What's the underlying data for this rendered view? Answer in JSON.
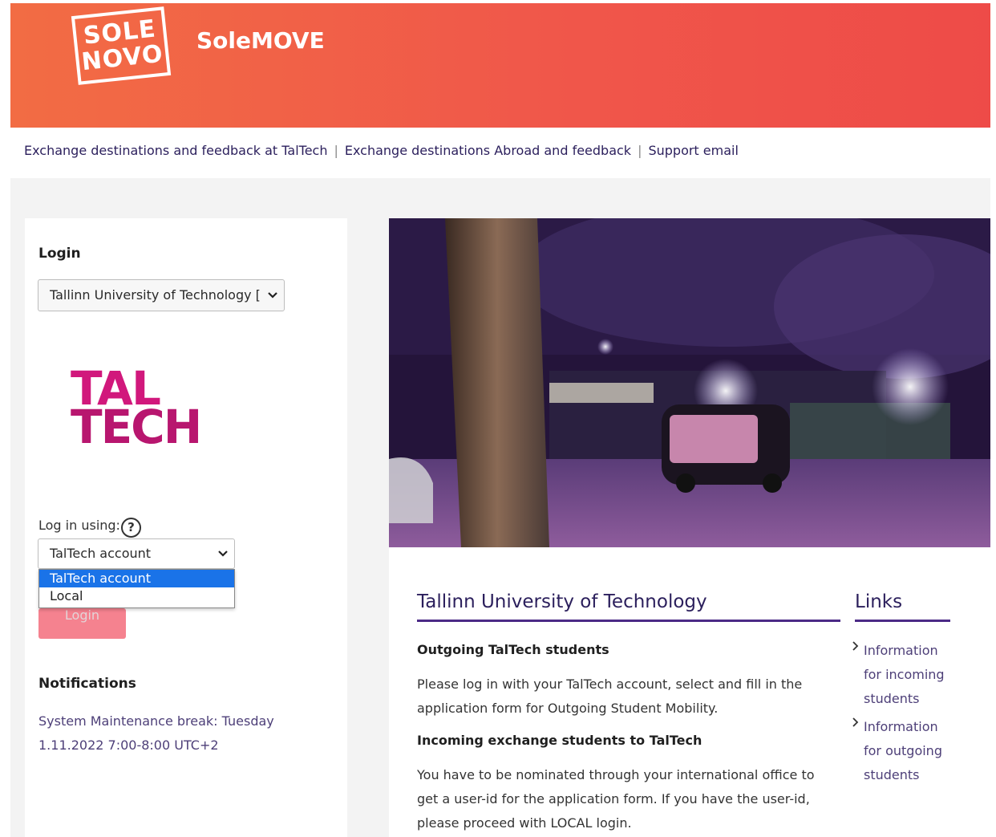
{
  "header": {
    "logo_line1": "SOLE",
    "logo_line2": "NOVO",
    "brand": "SoleMOVE"
  },
  "top_links": [
    "Exchange destinations and feedback at TalTech",
    "Exchange destinations Abroad and feedback",
    "Support email"
  ],
  "login": {
    "heading": "Login",
    "institution_select_value": "Tallinn University of Technology [Tallinn",
    "institution_logo_line1": "TAL",
    "institution_logo_line2": "TECH",
    "log_in_using_label": "Log in using:",
    "help_icon": "?",
    "method_select_value": "TalTech account",
    "method_options": [
      "TalTech account",
      "Local"
    ],
    "button_label": "Login"
  },
  "notifications": {
    "heading": "Notifications",
    "text": "System Maintenance break: Tuesday 1.11.2022 7:00-8:00 UTC+2"
  },
  "main": {
    "title": "Tallinn University of Technology",
    "outgoing_heading": "Outgoing TalTech students",
    "outgoing_text": "Please log in with your TalTech account, select and fill in the application form for Outgoing Student Mobility.",
    "incoming_heading": "Incoming exchange students to TalTech",
    "incoming_text": "You have to be nominated through your international office to get a user-id for the application form. If you have the user-id, please proceed with LOCAL login."
  },
  "links": {
    "title": "Links",
    "items": [
      "Information for incoming students",
      "Information for outgoing students"
    ]
  },
  "colors": {
    "header_gradient_start": "#f26c44",
    "header_gradient_end": "#ee4b48",
    "brand_purple": "#2b1f5c",
    "taltech_magenta": "#d1187c",
    "login_button": "#f5828f",
    "dropdown_selected": "#1a73e8"
  }
}
